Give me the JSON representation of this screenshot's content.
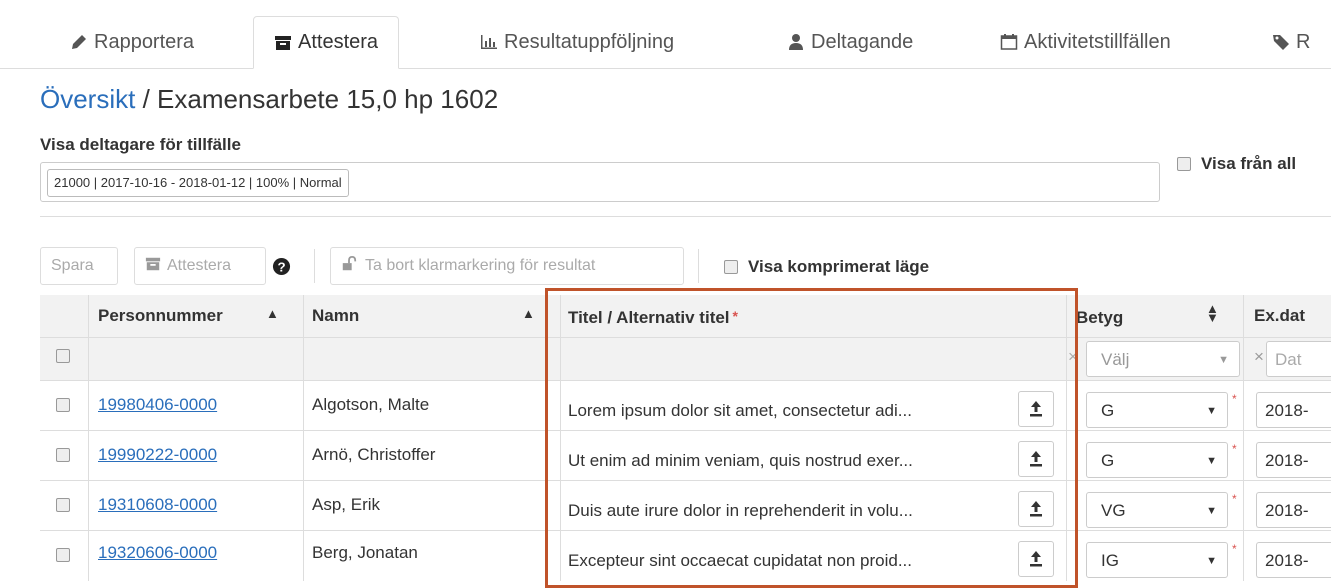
{
  "tabs": [
    {
      "label": "Rapportera",
      "icon": "pencil-icon"
    },
    {
      "label": "Attestera",
      "icon": "archive-icon"
    },
    {
      "label": "Resultatuppföljning",
      "icon": "bar-chart-icon"
    },
    {
      "label": "Deltagande",
      "icon": "user-icon"
    },
    {
      "label": "Aktivitetstillfällen",
      "icon": "calendar-icon"
    },
    {
      "label": "R",
      "icon": "tag-icon"
    }
  ],
  "breadcrumb": {
    "link": "Översikt",
    "separator": " / ",
    "current": "Examensarbete 15,0 hp 1602"
  },
  "occasion": {
    "label": "Visa deltagare för tillfälle",
    "selected": "21000 | 2017-10-16 - 2018-01-12 | 100% | Normal",
    "show_all_label": "Visa från all"
  },
  "toolbar": {
    "save": "Spara",
    "attest": "Attestera",
    "help_icon": "question-circle-icon",
    "remove_mark": "Ta bort klarmarkering för resultat",
    "compact_label": "Visa komprimerat läge"
  },
  "table": {
    "headers": {
      "pnr": "Personnummer",
      "name": "Namn",
      "title": "Titel / Alternativ titel",
      "title_required": "*",
      "grade": "Betyg",
      "exdate": "Ex.dat"
    },
    "filters": {
      "grade_placeholder": "Välj",
      "date_placeholder": "Dat",
      "clear": "×"
    },
    "rows": [
      {
        "pnr": "19980406-0000",
        "name": "Algotson, Malte",
        "title": "Lorem ipsum dolor sit amet, consectetur adi...",
        "grade": "G",
        "date": "2018-"
      },
      {
        "pnr": "19990222-0000",
        "name": "Arnö, Christoffer",
        "title": "Ut enim ad minim veniam, quis nostrud exer...",
        "grade": "G",
        "date": "2018-"
      },
      {
        "pnr": "19310608-0000",
        "name": "Asp, Erik",
        "title": "Duis aute irure dolor in reprehenderit in volu...",
        "grade": "VG",
        "date": "2018-"
      },
      {
        "pnr": "19320606-0000",
        "name": "Berg, Jonatan",
        "title": "Excepteur sint occaecat cupidatat non proid...",
        "grade": "IG",
        "date": "2018-"
      }
    ]
  },
  "colors": {
    "link": "#2a6ebb",
    "highlight": "#c0532a",
    "required": "#d9534f"
  }
}
